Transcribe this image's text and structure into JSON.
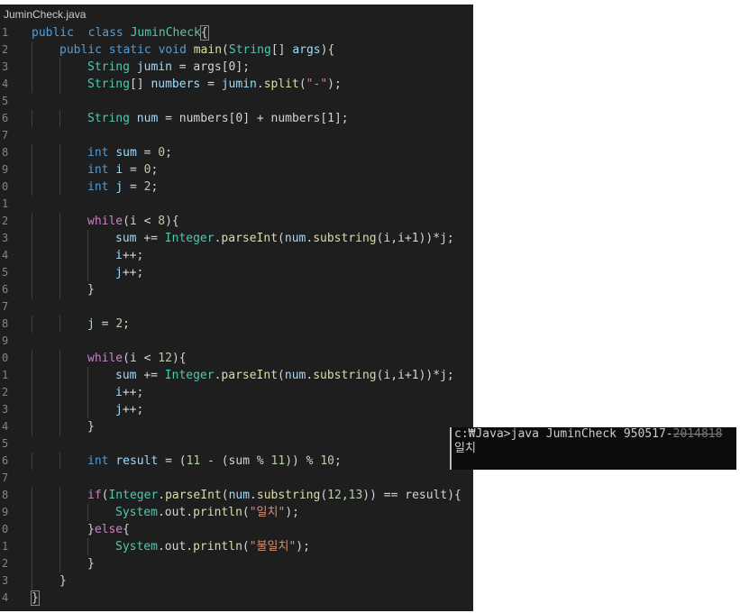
{
  "tab": {
    "filename": "JuminCheck.java"
  },
  "editor": {
    "line_numbers": [
      "1",
      "2",
      "3",
      "4",
      "5",
      "6",
      "7",
      "8",
      "9",
      "0",
      "1",
      "2",
      "3",
      "4",
      "5",
      "6",
      "7",
      "8",
      "9",
      "0",
      "1",
      "2",
      "3",
      "4",
      "5",
      "6",
      "7",
      "8",
      "9",
      "0",
      "1",
      "2",
      "3",
      "4"
    ],
    "lines": [
      {
        "indent": 0,
        "tokens": [
          [
            "kw",
            "public"
          ],
          [
            "",
            "  "
          ],
          [
            "kw",
            "class"
          ],
          [
            "",
            " "
          ],
          [
            "ty",
            "JuminCheck"
          ],
          [
            "cur",
            "{"
          ]
        ]
      },
      {
        "indent": 1,
        "tokens": [
          [
            "kw",
            "public"
          ],
          [
            "",
            " "
          ],
          [
            "kw",
            "static"
          ],
          [
            "",
            " "
          ],
          [
            "kw",
            "void"
          ],
          [
            "",
            " "
          ],
          [
            "fn",
            "main"
          ],
          [
            "",
            "("
          ],
          [
            "ty",
            "String"
          ],
          [
            "",
            "[] "
          ],
          [
            "var",
            "args"
          ],
          [
            "",
            "){"
          ]
        ]
      },
      {
        "indent": 2,
        "tokens": [
          [
            "ty",
            "String"
          ],
          [
            "",
            " "
          ],
          [
            "var",
            "jumin"
          ],
          [
            "",
            " = args[0];"
          ]
        ]
      },
      {
        "indent": 2,
        "tokens": [
          [
            "ty",
            "String"
          ],
          [
            "",
            "[] "
          ],
          [
            "var",
            "numbers"
          ],
          [
            "",
            " = "
          ],
          [
            "var",
            "jumin"
          ],
          [
            "",
            "."
          ],
          [
            "fn",
            "split"
          ],
          [
            "",
            "("
          ],
          [
            "str",
            "\"-\""
          ],
          [
            "",
            ");"
          ]
        ]
      },
      {
        "indent": 0,
        "tokens": []
      },
      {
        "indent": 2,
        "tokens": [
          [
            "ty",
            "String"
          ],
          [
            "",
            " "
          ],
          [
            "var",
            "num"
          ],
          [
            "",
            " = numbers[0] + numbers[1];"
          ]
        ]
      },
      {
        "indent": 0,
        "tokens": []
      },
      {
        "indent": 2,
        "tokens": [
          [
            "kw",
            "int"
          ],
          [
            "",
            " "
          ],
          [
            "var",
            "sum"
          ],
          [
            "",
            " = "
          ],
          [
            "num",
            "0"
          ],
          [
            "",
            ";"
          ]
        ]
      },
      {
        "indent": 2,
        "tokens": [
          [
            "kw",
            "int"
          ],
          [
            "",
            " "
          ],
          [
            "var",
            "i"
          ],
          [
            "",
            " = "
          ],
          [
            "num",
            "0"
          ],
          [
            "",
            ";"
          ]
        ]
      },
      {
        "indent": 2,
        "tokens": [
          [
            "kw",
            "int"
          ],
          [
            "",
            " "
          ],
          [
            "var",
            "j"
          ],
          [
            "",
            " = "
          ],
          [
            "num",
            "2"
          ],
          [
            "",
            ";"
          ]
        ]
      },
      {
        "indent": 0,
        "tokens": []
      },
      {
        "indent": 2,
        "tokens": [
          [
            "ctl",
            "while"
          ],
          [
            "",
            "(i < "
          ],
          [
            "num",
            "8"
          ],
          [
            "",
            "){"
          ]
        ]
      },
      {
        "indent": 3,
        "tokens": [
          [
            "var",
            "sum"
          ],
          [
            "",
            " += "
          ],
          [
            "ty",
            "Integer"
          ],
          [
            "",
            "."
          ],
          [
            "fn",
            "parseInt"
          ],
          [
            "",
            "("
          ],
          [
            "var",
            "num"
          ],
          [
            "",
            "."
          ],
          [
            "fn",
            "substring"
          ],
          [
            "",
            "(i,i+1))*j;"
          ]
        ]
      },
      {
        "indent": 3,
        "tokens": [
          [
            "var",
            "i"
          ],
          [
            "",
            "++;"
          ]
        ]
      },
      {
        "indent": 3,
        "tokens": [
          [
            "var",
            "j"
          ],
          [
            "",
            "++;"
          ]
        ]
      },
      {
        "indent": 2,
        "tokens": [
          [
            "",
            "}"
          ]
        ]
      },
      {
        "indent": 0,
        "tokens": []
      },
      {
        "indent": 2,
        "tokens": [
          [
            "var",
            "j"
          ],
          [
            "",
            " = "
          ],
          [
            "num",
            "2"
          ],
          [
            "",
            ";"
          ]
        ]
      },
      {
        "indent": 0,
        "tokens": []
      },
      {
        "indent": 2,
        "tokens": [
          [
            "ctl",
            "while"
          ],
          [
            "",
            "(i < "
          ],
          [
            "num",
            "12"
          ],
          [
            "",
            "){"
          ]
        ]
      },
      {
        "indent": 3,
        "tokens": [
          [
            "var",
            "sum"
          ],
          [
            "",
            " += "
          ],
          [
            "ty",
            "Integer"
          ],
          [
            "",
            "."
          ],
          [
            "fn",
            "parseInt"
          ],
          [
            "",
            "("
          ],
          [
            "var",
            "num"
          ],
          [
            "",
            "."
          ],
          [
            "fn",
            "substring"
          ],
          [
            "",
            "(i,i+1))*j;"
          ]
        ]
      },
      {
        "indent": 3,
        "tokens": [
          [
            "var",
            "i"
          ],
          [
            "",
            "++;"
          ]
        ]
      },
      {
        "indent": 3,
        "tokens": [
          [
            "var",
            "j"
          ],
          [
            "",
            "++;"
          ]
        ]
      },
      {
        "indent": 2,
        "tokens": [
          [
            "",
            "}"
          ]
        ]
      },
      {
        "indent": 0,
        "tokens": []
      },
      {
        "indent": 2,
        "tokens": [
          [
            "kw",
            "int"
          ],
          [
            "",
            " "
          ],
          [
            "var",
            "result"
          ],
          [
            "",
            " = ("
          ],
          [
            "num",
            "11"
          ],
          [
            "",
            " - (sum % "
          ],
          [
            "num",
            "11"
          ],
          [
            "",
            "))"
          ],
          [
            "",
            " % "
          ],
          [
            "num",
            "10"
          ],
          [
            "",
            ";"
          ]
        ]
      },
      {
        "indent": 0,
        "tokens": []
      },
      {
        "indent": 2,
        "tokens": [
          [
            "ctl",
            "if"
          ],
          [
            "",
            "("
          ],
          [
            "ty",
            "Integer"
          ],
          [
            "",
            "."
          ],
          [
            "fn",
            "parseInt"
          ],
          [
            "",
            "("
          ],
          [
            "var",
            "num"
          ],
          [
            "",
            "."
          ],
          [
            "fn",
            "substring"
          ],
          [
            "",
            "("
          ],
          [
            "num",
            "12"
          ],
          [
            "",
            ","
          ],
          [
            "num",
            "13"
          ],
          [
            "",
            ")) == result){"
          ]
        ]
      },
      {
        "indent": 3,
        "tokens": [
          [
            "ty",
            "System"
          ],
          [
            "",
            ".out."
          ],
          [
            "fn",
            "println"
          ],
          [
            "",
            "("
          ],
          [
            "str",
            "\"일치\""
          ],
          [
            "",
            ");"
          ]
        ]
      },
      {
        "indent": 2,
        "tokens": [
          [
            "",
            "}"
          ],
          [
            "ctl",
            "else"
          ],
          [
            "",
            "{"
          ]
        ]
      },
      {
        "indent": 3,
        "tokens": [
          [
            "ty",
            "System"
          ],
          [
            "",
            ".out."
          ],
          [
            "fn",
            "println"
          ],
          [
            "",
            "("
          ],
          [
            "str",
            "\"불일치\""
          ],
          [
            "",
            ");"
          ]
        ]
      },
      {
        "indent": 2,
        "tokens": [
          [
            "",
            "}"
          ]
        ]
      },
      {
        "indent": 1,
        "tokens": [
          [
            "",
            "}"
          ]
        ]
      },
      {
        "indent": 0,
        "tokens": [
          [
            "cur",
            "}"
          ]
        ]
      }
    ]
  },
  "console": {
    "prompt": "c:₩Java>java JuminCheck 950517-",
    "redacted": "2014818",
    "output": "일치"
  },
  "colors": {
    "editor_bg": "#1e1e1e",
    "keyword": "#569cd6",
    "control": "#c586c0",
    "type": "#4ec9b0",
    "function": "#dcdcaa",
    "variable": "#9cdcfe",
    "number": "#b5cea8",
    "string": "#ce9178",
    "console_bg": "#0c0c0c"
  }
}
